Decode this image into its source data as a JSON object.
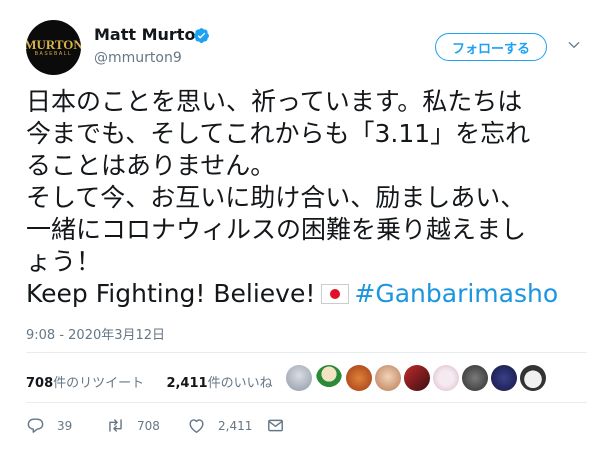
{
  "author": {
    "display_name": "Matt Murton",
    "handle": "@mmurton9",
    "avatar_line1": "MURTON",
    "avatar_line2": "BASEBALL"
  },
  "follow_button": {
    "label": "フォローする"
  },
  "tweet": {
    "lines": [
      "日本のことを思い、祈っています。私たちは",
      "今までも、そしてこれからも「3.11」を忘れ",
      "ることはありません。",
      "そして今、お互いに助け合い、励ましあい、",
      "一緒にコロナウィルスの困難を乗り越えまし",
      "ょう！"
    ],
    "last_line_text": "Keep Fighting! Believe!",
    "flag_emoji": "japan-flag",
    "hashtag": "#Ganbarimasho"
  },
  "timestamp": "9:08 - 2020年3月12日",
  "stats": {
    "retweets_count": "708",
    "retweets_label": "件のリツイート",
    "likes_count": "2,411",
    "likes_label": "件のいいね"
  },
  "actions": {
    "reply_count": "39",
    "retweet_count": "708",
    "like_count": "2,411"
  },
  "colors": {
    "accent": "#1da1f2",
    "hashtag": "#1b95e0",
    "text": "#14171a",
    "muted": "#657786",
    "divider": "#e6ecf0"
  }
}
